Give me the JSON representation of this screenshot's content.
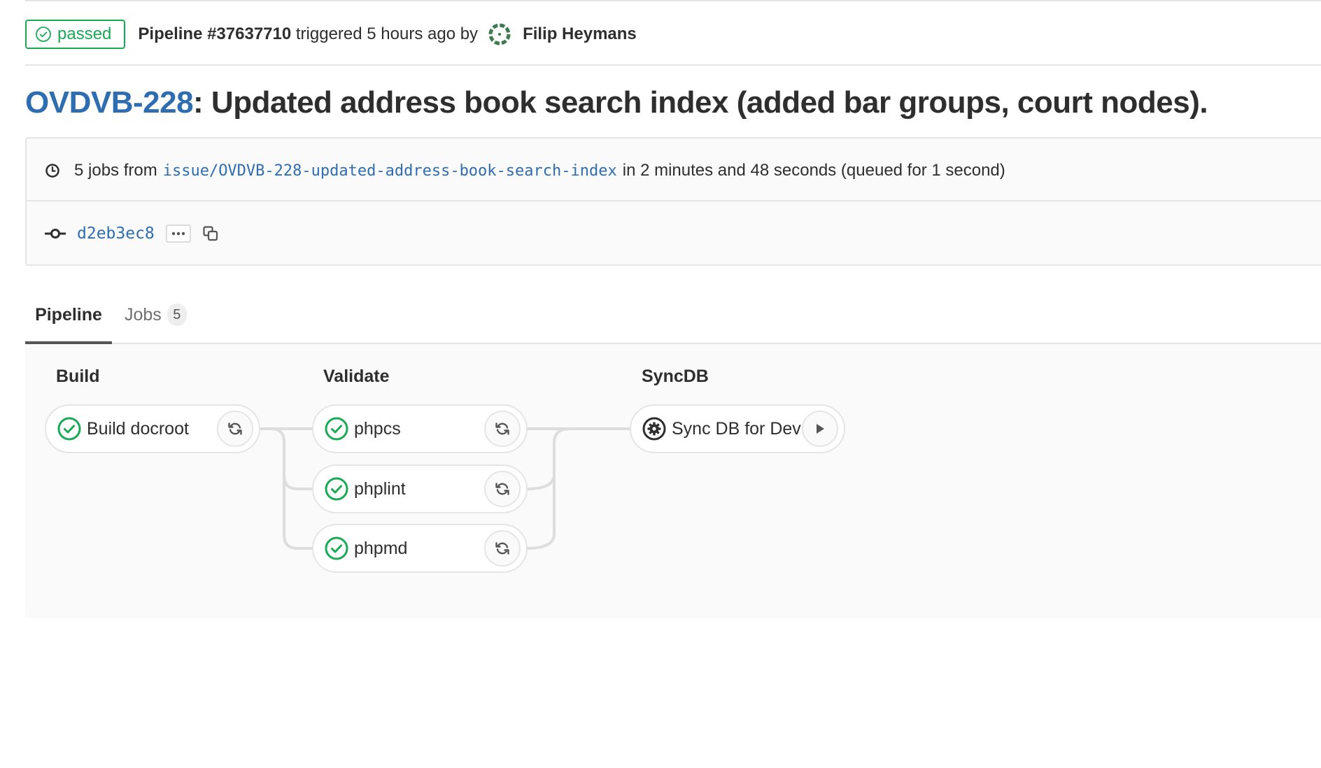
{
  "header": {
    "status": "passed",
    "pipeline_label": "Pipeline #37637710",
    "triggered_text": "triggered 5 hours ago by",
    "author": "Filip Heymans"
  },
  "title": {
    "issue_key": "OVDVB-228",
    "text": ": Updated address book search index (added bar groups, court nodes)."
  },
  "info": {
    "jobs_prefix": "5 jobs from",
    "branch": "issue/OVDVB-228-updated-address-book-search-index",
    "duration_text": "in 2 minutes and 48 seconds (queued for 1 second)",
    "commit_sha": "d2eb3ec8"
  },
  "tabs": [
    {
      "label": "Pipeline",
      "active": true
    },
    {
      "label": "Jobs",
      "count": "5"
    }
  ],
  "stages": [
    {
      "name": "Build",
      "jobs": [
        {
          "name": "Build docroot",
          "status": "success",
          "action": "retry"
        }
      ]
    },
    {
      "name": "Validate",
      "jobs": [
        {
          "name": "phpcs",
          "status": "success",
          "action": "retry"
        },
        {
          "name": "phplint",
          "status": "success",
          "action": "retry"
        },
        {
          "name": "phpmd",
          "status": "success",
          "action": "retry"
        }
      ]
    },
    {
      "name": "SyncDB",
      "jobs": [
        {
          "name": "Sync DB for Dev",
          "status": "manual",
          "action": "play"
        }
      ]
    }
  ],
  "colors": {
    "success": "#1aaa55",
    "link": "#2f6db1",
    "border": "#e5e5e5"
  }
}
